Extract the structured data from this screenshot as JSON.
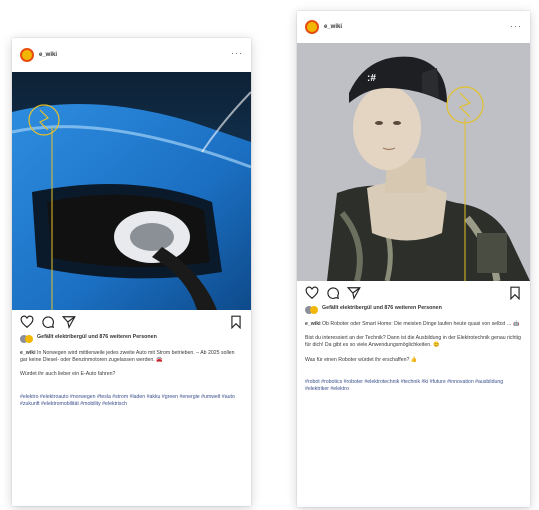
{
  "post1": {
    "username": "e_wiki",
    "more_label": "···",
    "likes_text": "Gefällt elektribergül und 876 weiteren Personen",
    "caption_user": "e_wiki",
    "caption_text": " In Norwegen wird mittlerweile jedes zweite Auto mit Strom betrieben. – Ab 2025 sollen gar keine Diesel- oder Benzinmotoren zugelassen werden. 🚘",
    "question": "Würdet ihr auch lieber ein E-Auto fahren?",
    "hashtags": "#elektro #elektroauto #norwegen #tesla #strom #laden #akku #green #energie #umwelt #auto #zukunft #elektromobilität #mobility #elektrisch"
  },
  "post2": {
    "username": "e_wiki",
    "more_label": "···",
    "likes_text": "Gefällt elektribergül und 876 weiteren Personen",
    "caption_user": "e_wiki",
    "caption_text": " Ob Roboter oder Smart Home: Die meisten Dinge laufen heute quasi von selbst … 🤖",
    "paragraph": "Bist du interessiert an der Technik? Dann ist die Ausbildung in der Elektrotechnik genau richtig für dich! Da gibt es so viele Anwendungsmöglichkeiten. 😊",
    "question": "Was für einen Roboter würdet ihr erschaffen? 👍",
    "hashtags": "#robot #robotics #roboter #elektrotechnik #technik #ki #future #innovation #ausbildung #elektriker #elektro"
  },
  "icons": [
    "heart-icon",
    "comment-icon",
    "share-icon",
    "save-icon",
    "more-icon",
    "overlay-logo-icon"
  ],
  "colors": {
    "avatar_yellow": "#f2b705",
    "avatar_ring": "#e84c0f",
    "overlay_line": "#e3c12b",
    "car_blue": "#1e73c6",
    "robot_bg": "#c2c5c9",
    "hashtag": "#3a4f8c"
  }
}
